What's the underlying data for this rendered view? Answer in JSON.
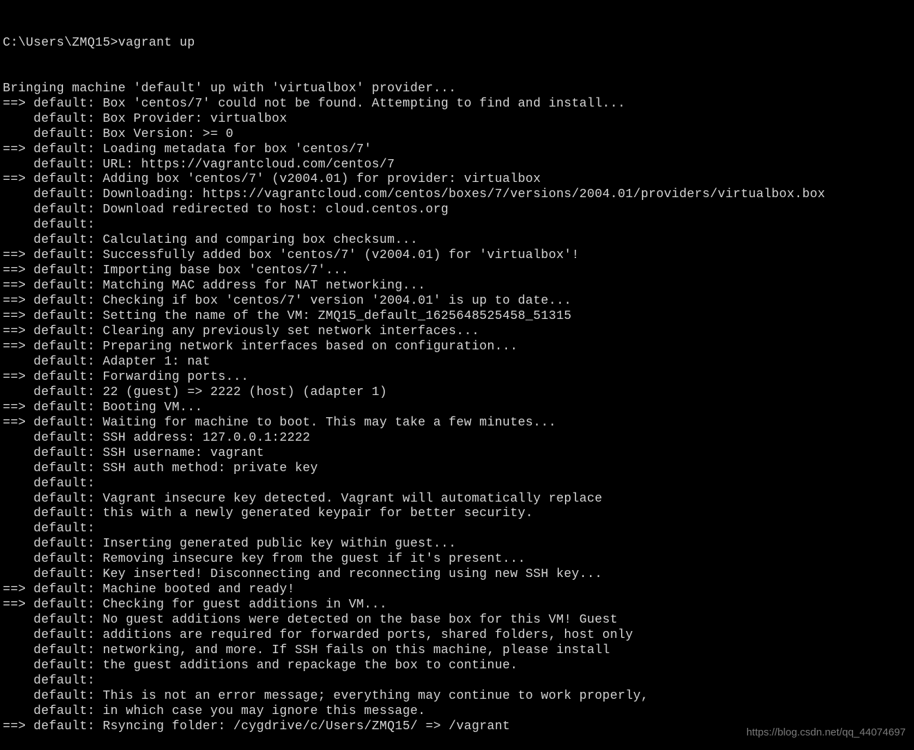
{
  "prompt": "C:\\Users\\ZMQ15>vagrant up",
  "lines": [
    "Bringing machine 'default' up with 'virtualbox' provider...",
    "==> default: Box 'centos/7' could not be found. Attempting to find and install...",
    "    default: Box Provider: virtualbox",
    "    default: Box Version: >= 0",
    "==> default: Loading metadata for box 'centos/7'",
    "    default: URL: https://vagrantcloud.com/centos/7",
    "==> default: Adding box 'centos/7' (v2004.01) for provider: virtualbox",
    "    default: Downloading: https://vagrantcloud.com/centos/boxes/7/versions/2004.01/providers/virtualbox.box",
    "    default: Download redirected to host: cloud.centos.org",
    "    default:",
    "    default: Calculating and comparing box checksum...",
    "==> default: Successfully added box 'centos/7' (v2004.01) for 'virtualbox'!",
    "==> default: Importing base box 'centos/7'...",
    "==> default: Matching MAC address for NAT networking...",
    "==> default: Checking if box 'centos/7' version '2004.01' is up to date...",
    "==> default: Setting the name of the VM: ZMQ15_default_1625648525458_51315",
    "==> default: Clearing any previously set network interfaces...",
    "==> default: Preparing network interfaces based on configuration...",
    "    default: Adapter 1: nat",
    "==> default: Forwarding ports...",
    "    default: 22 (guest) => 2222 (host) (adapter 1)",
    "==> default: Booting VM...",
    "==> default: Waiting for machine to boot. This may take a few minutes...",
    "    default: SSH address: 127.0.0.1:2222",
    "    default: SSH username: vagrant",
    "    default: SSH auth method: private key",
    "    default:",
    "    default: Vagrant insecure key detected. Vagrant will automatically replace",
    "    default: this with a newly generated keypair for better security.",
    "    default:",
    "    default: Inserting generated public key within guest...",
    "    default: Removing insecure key from the guest if it's present...",
    "    default: Key inserted! Disconnecting and reconnecting using new SSH key...",
    "==> default: Machine booted and ready!",
    "==> default: Checking for guest additions in VM...",
    "    default: No guest additions were detected on the base box for this VM! Guest",
    "    default: additions are required for forwarded ports, shared folders, host only",
    "    default: networking, and more. If SSH fails on this machine, please install",
    "    default: the guest additions and repackage the box to continue.",
    "    default:",
    "    default: This is not an error message; everything may continue to work properly,",
    "    default: in which case you may ignore this message.",
    "==> default: Rsyncing folder: /cygdrive/c/Users/ZMQ15/ => /vagrant"
  ],
  "watermark": "https://blog.csdn.net/qq_44074697"
}
